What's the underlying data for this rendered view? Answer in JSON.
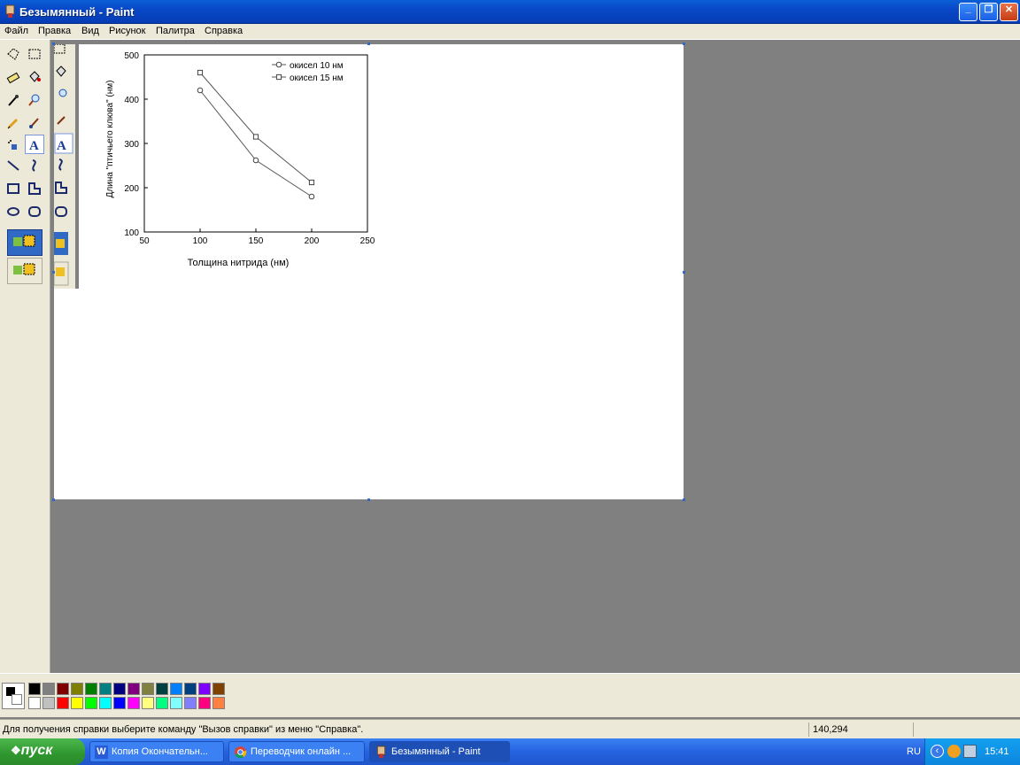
{
  "window": {
    "title": "Безымянный - Paint",
    "minimize": "_",
    "maximize": "❐",
    "close": "✕"
  },
  "menu": [
    "Файл",
    "Правка",
    "Вид",
    "Рисунок",
    "Палитра",
    "Справка"
  ],
  "chart_data": {
    "type": "line",
    "xlabel": "Толщина нитрида (нм)",
    "ylabel": "Длина \"птичьего клюва\" (нм)",
    "xlim": [
      50,
      250
    ],
    "ylim": [
      100,
      500
    ],
    "xticks": [
      "50",
      "100",
      "150",
      "200",
      "250"
    ],
    "yticks": [
      "100",
      "200",
      "300",
      "400",
      "500"
    ],
    "legend_position": "top-right",
    "x": [
      100,
      150,
      200
    ],
    "series": [
      {
        "name": "окисел 10 нм",
        "marker": "circle",
        "values": [
          420,
          262,
          180
        ]
      },
      {
        "name": "окисел 15 нм",
        "marker": "square",
        "values": [
          460,
          315,
          212
        ]
      }
    ]
  },
  "palette": [
    "#000000",
    "#808080",
    "#800000",
    "#808000",
    "#008000",
    "#008080",
    "#000080",
    "#800080",
    "#808040",
    "#004040",
    "#0080ff",
    "#004080",
    "#8000ff",
    "#804000",
    "#ffffff",
    "#c0c0c0",
    "#ff0000",
    "#ffff00",
    "#00ff00",
    "#00ffff",
    "#0000ff",
    "#ff00ff",
    "#ffff80",
    "#00ff80",
    "#80ffff",
    "#8080ff",
    "#ff0080",
    "#ff8040"
  ],
  "status": {
    "help": "Для получения справки выберите команду \"Вызов справки\" из меню \"Справка\".",
    "coords": "140,294"
  },
  "taskbar": {
    "start": "пуск",
    "tasks": [
      "Копия Окончательн...",
      "Переводчик онлайн ...",
      "Безымянный - Paint"
    ],
    "lang": "RU",
    "clock": "15:41"
  }
}
